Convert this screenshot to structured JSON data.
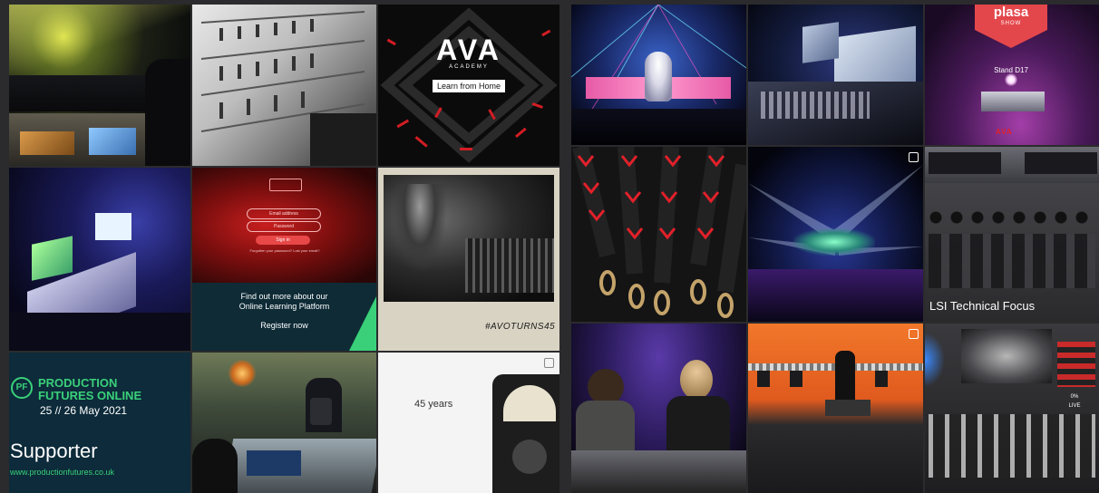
{
  "left_grid": {
    "ava_academy": {
      "logo_text": "AVA",
      "logo_sub": "ACADEMY",
      "cta": "Learn from Home"
    },
    "platform": {
      "fields": [
        "Email address",
        "Password"
      ],
      "sign_in": "Sign in",
      "forgot": "Forgotten your password? Lost your email?",
      "heading_line1": "Find out more about our",
      "heading_line2": "Online Learning Platform",
      "register": "Register now"
    },
    "ava_turns": {
      "hashtag": "#AVOTURNS45"
    },
    "production_futures": {
      "pf_mark": "PF",
      "line1": "PRODUCTION",
      "line2": "FUTURES ONLINE",
      "dates": "25 // 26 May 2021",
      "role": "Supporter",
      "url": "www.productionfutures.co.uk"
    },
    "avo_years": {
      "text": "45 years"
    }
  },
  "right_grid": {
    "plasa": {
      "brand": "plasa",
      "brand_sub": "SHOW",
      "stand": "Stand D17",
      "logo": "AVA"
    },
    "lsi": {
      "caption": "LSI Technical Focus"
    },
    "console": {
      "key1": "0%",
      "key2": "LIVE"
    }
  },
  "colors": {
    "page_bg": "#2b2b2d",
    "ava_red": "#e3202a",
    "pf_green": "#3ad07a",
    "pf_navy": "#0d2b3a"
  }
}
